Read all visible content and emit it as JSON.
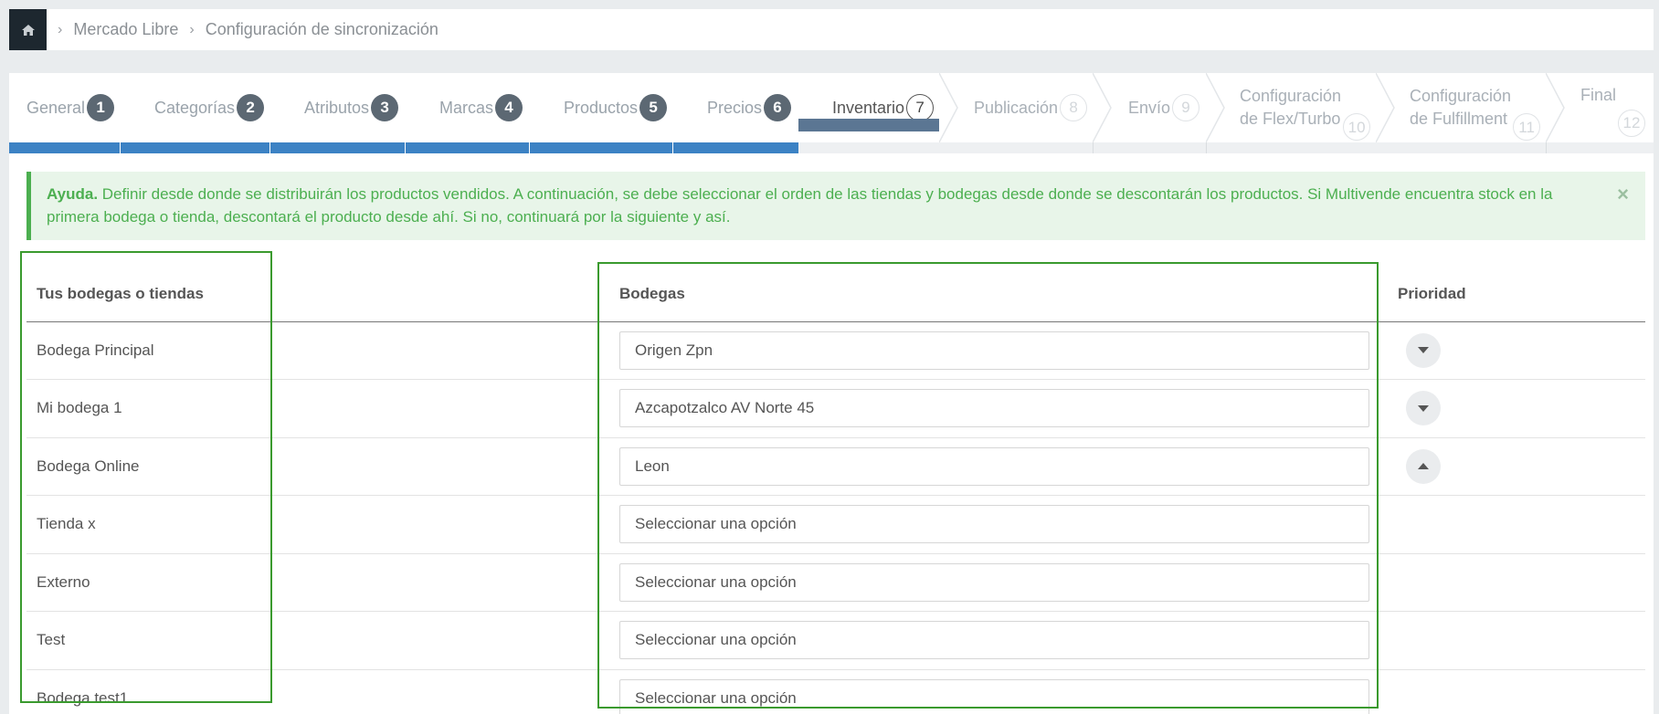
{
  "breadcrumb": {
    "items": [
      "Mercado Libre",
      "Configuración de sincronización"
    ]
  },
  "wizard": {
    "steps": [
      {
        "label": "General",
        "num": "1"
      },
      {
        "label": "Categorías",
        "num": "2"
      },
      {
        "label": "Atributos",
        "num": "3"
      },
      {
        "label": "Marcas",
        "num": "4"
      },
      {
        "label": "Productos",
        "num": "5"
      },
      {
        "label": "Precios",
        "num": "6"
      },
      {
        "label": "Inventario",
        "num": "7"
      },
      {
        "label": "Publicación",
        "num": "8"
      },
      {
        "label": "Envío",
        "num": "9"
      },
      {
        "label_line1": "Configuración",
        "label_line2": "de Flex/Turbo",
        "num": "10"
      },
      {
        "label_line1": "Configuración",
        "label_line2": "de Fulfillment",
        "num": "11"
      },
      {
        "label": "Final",
        "num": "12"
      }
    ],
    "active_step": 7
  },
  "alert": {
    "title": "Ayuda.",
    "text": "Definir desde donde se distribuirán los productos vendidos. A continuación, se debe seleccionar el orden de las tiendas y bodegas desde donde se descontarán los productos. Si Multivende encuentra stock en la primera bodega o tienda, descontará el producto desde ahí. Si no, continuará por la siguiente y así.",
    "close": "×"
  },
  "table": {
    "headers": {
      "stores": "Tus bodegas o tiendas",
      "warehouses": "Bodegas",
      "priority": "Prioridad"
    },
    "rows": [
      {
        "store": "Bodega Principal",
        "warehouse": "Origen Zpn",
        "priority": "down"
      },
      {
        "store": "Mi bodega 1",
        "warehouse": "Azcapotzalco AV Norte 45",
        "priority": "down"
      },
      {
        "store": "Bodega Online",
        "warehouse": "Leon",
        "priority": "up"
      },
      {
        "store": "Tienda x",
        "warehouse": "Seleccionar una opción",
        "priority": ""
      },
      {
        "store": "Externo",
        "warehouse": "Seleccionar una opción",
        "priority": ""
      },
      {
        "store": "Test",
        "warehouse": "Seleccionar una opción",
        "priority": ""
      },
      {
        "store": "Bodega test1",
        "warehouse": "Seleccionar una opción",
        "priority": ""
      }
    ]
  },
  "colors": {
    "accent": "#3c82c4",
    "alert_green": "#4caf50",
    "highlight": "#3a9a2e",
    "dark": "#1d272f"
  },
  "icons": {
    "home": "home-icon",
    "chevron": "chevron-right-icon",
    "caret_down": "caret-down-icon",
    "caret_up": "caret-up-icon"
  }
}
